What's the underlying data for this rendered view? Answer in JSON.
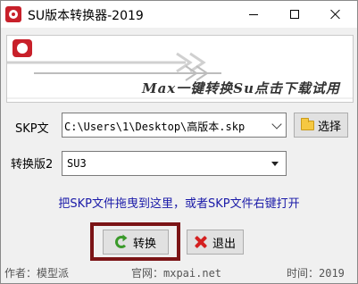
{
  "window": {
    "title": "SU版本转换器-2019",
    "icon": "sketchup-logo-icon"
  },
  "banner": {
    "tagline": "Max一键转换Su点击下载试用"
  },
  "form": {
    "skp_label": "SKP文",
    "skp_path": "C:\\Users\\1\\Desktop\\高版本.skp",
    "select_button": "选择",
    "version_label": "转换版2",
    "version_value": "SU3"
  },
  "hint": "把SKP文件拖曳到这里，或者SKP文件右键打开",
  "actions": {
    "convert": "转换",
    "exit": "退出"
  },
  "footer": {
    "author": "作者：模型派",
    "site": "官网：mxpai.net",
    "time": "时间：2019"
  },
  "colors": {
    "hint_text": "#1a1aa8",
    "convert_highlight": "#7b1416",
    "logo_red": "#c8202a"
  }
}
